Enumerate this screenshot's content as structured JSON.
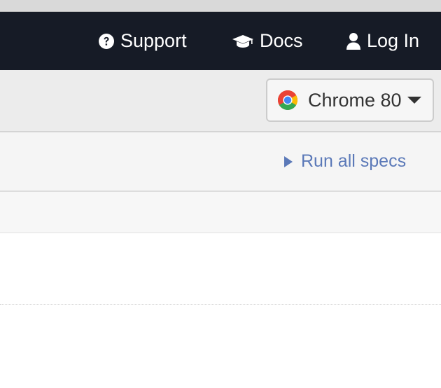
{
  "nav": {
    "support_label": "Support",
    "docs_label": "Docs",
    "login_label": "Log In",
    "icons": [
      "question-circle-icon",
      "graduation-cap-icon",
      "user-icon"
    ]
  },
  "toolbar": {
    "browser_label": "Chrome 80",
    "browser_icon": "chrome-icon"
  },
  "specs": {
    "run_all_label": "Run all specs"
  },
  "colors": {
    "navbar_bg": "#161b26",
    "link_blue": "#5b79b8",
    "toolbar_bg": "#ececec"
  }
}
